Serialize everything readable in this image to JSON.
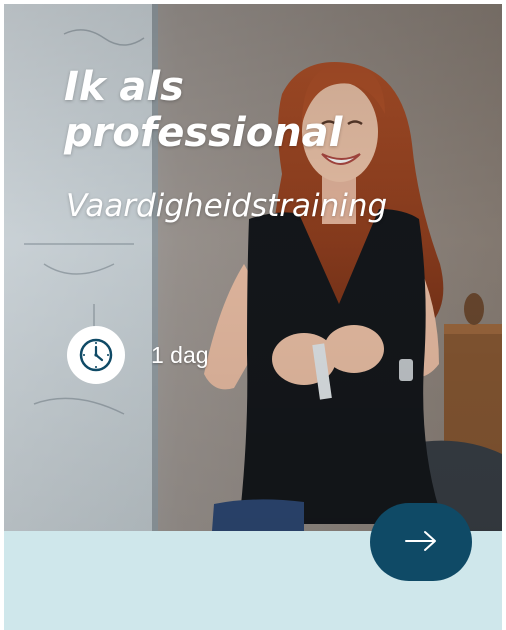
{
  "card": {
    "title": "Ik als professional",
    "subtitle": "Vaardigheidstraining",
    "duration": {
      "icon": "clock-icon",
      "label": "1 dag"
    },
    "action": {
      "icon": "arrow-right-icon"
    }
  },
  "colors": {
    "accent": "#0f4a66",
    "footer_background": "#cfe7eb",
    "text_on_image": "#ffffff"
  }
}
